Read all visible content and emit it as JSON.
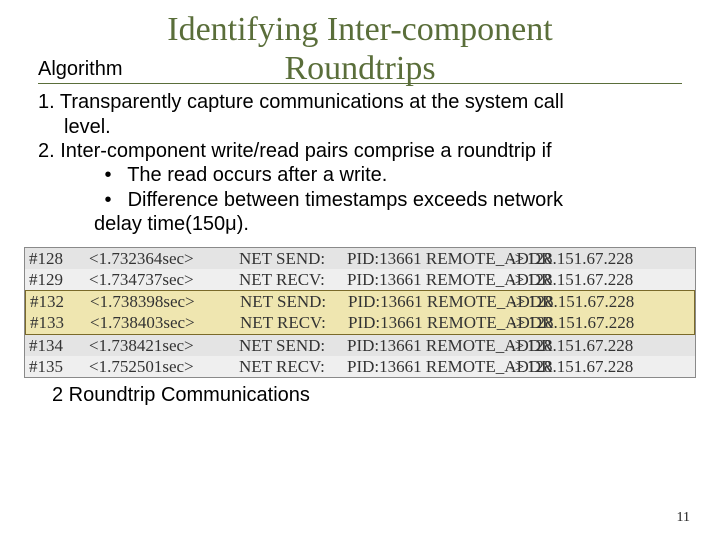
{
  "title_line1": "Identifying Inter-component",
  "title_line2": "Roundtrips",
  "algorithm_label": "Algorithm",
  "steps": {
    "s1": "1. Transparently capture communications at the system call",
    "s1b": "level.",
    "s2": "2. Inter-component write/read pairs comprise a roundtrip if",
    "b1": "The read occurs after a write.",
    "b2a": "Difference between timestamps exceeds network",
    "b2b": "delay time(150μ)."
  },
  "log": [
    {
      "id": "#128",
      "ts": "<1.732364sec>",
      "op": "NET SEND:",
      "pid": "PID:13661 REMOTE_ADDR",
      "arrow": "->",
      "addr": "128.151.67.228"
    },
    {
      "id": "#129",
      "ts": "<1.734737sec>",
      "op": "NET RECV:",
      "pid": "PID:13661 REMOTE_ADDR",
      "arrow": "->",
      "addr": "128.151.67.228"
    },
    {
      "id": "#132",
      "ts": "<1.738398sec>",
      "op": "NET SEND:",
      "pid": "PID:13661 REMOTE_ADDR",
      "arrow": "->",
      "addr": "128.151.67.228"
    },
    {
      "id": "#133",
      "ts": "<1.738403sec>",
      "op": "NET RECV:",
      "pid": "PID:13661 REMOTE_ADDR",
      "arrow": "->",
      "addr": "128.151.67.228"
    },
    {
      "id": "#134",
      "ts": "<1.738421sec>",
      "op": "NET SEND:",
      "pid": "PID:13661 REMOTE_ADDR",
      "arrow": "->",
      "addr": "128.151.67.228"
    },
    {
      "id": "#135",
      "ts": "<1.752501sec>",
      "op": "NET RECV:",
      "pid": "PID:13661 REMOTE_ADDR",
      "arrow": "->",
      "addr": "128.151.67.228"
    }
  ],
  "caption": "2 Roundtrip Communications",
  "page_number": "11",
  "bullet_char": "•"
}
